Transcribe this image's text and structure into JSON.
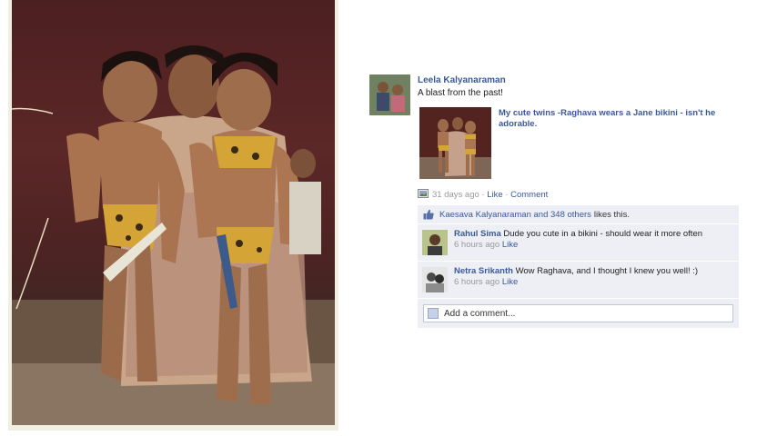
{
  "post": {
    "author": "Leela Kalyanaraman",
    "status": "A blast from the past!",
    "attachment_caption": "My cute twins -Raghava wears a Jane bikini - isn't he adorable.",
    "meta": {
      "time": "31 days ago",
      "separator1": " · ",
      "like_label": "Like",
      "separator2": " · ",
      "comment_label": "Comment"
    },
    "likes": {
      "names": "Kaesava Kalyanaraman and 348 others",
      "suffix": "likes this."
    },
    "comments": [
      {
        "name": "Rahul Sima",
        "text": "Dude you cute in a bikini - should wear it more often",
        "time": "6 hours ago",
        "like_label": "Like"
      },
      {
        "name": "Netra Srikanth",
        "text": "Wow Raghava, and I thought I knew you well! :)",
        "time": "6 hours ago",
        "like_label": "Like"
      }
    ],
    "add_comment_placeholder": "Add a comment..."
  },
  "icons": {
    "meta_icon": "photo-album-icon",
    "likes_icon": "thumbs-up-icon",
    "add_comment_icon": "user-picture-icon"
  },
  "colors": {
    "link": "#3b5998",
    "ufi_background": "#edeff4",
    "muted": "#999999"
  }
}
